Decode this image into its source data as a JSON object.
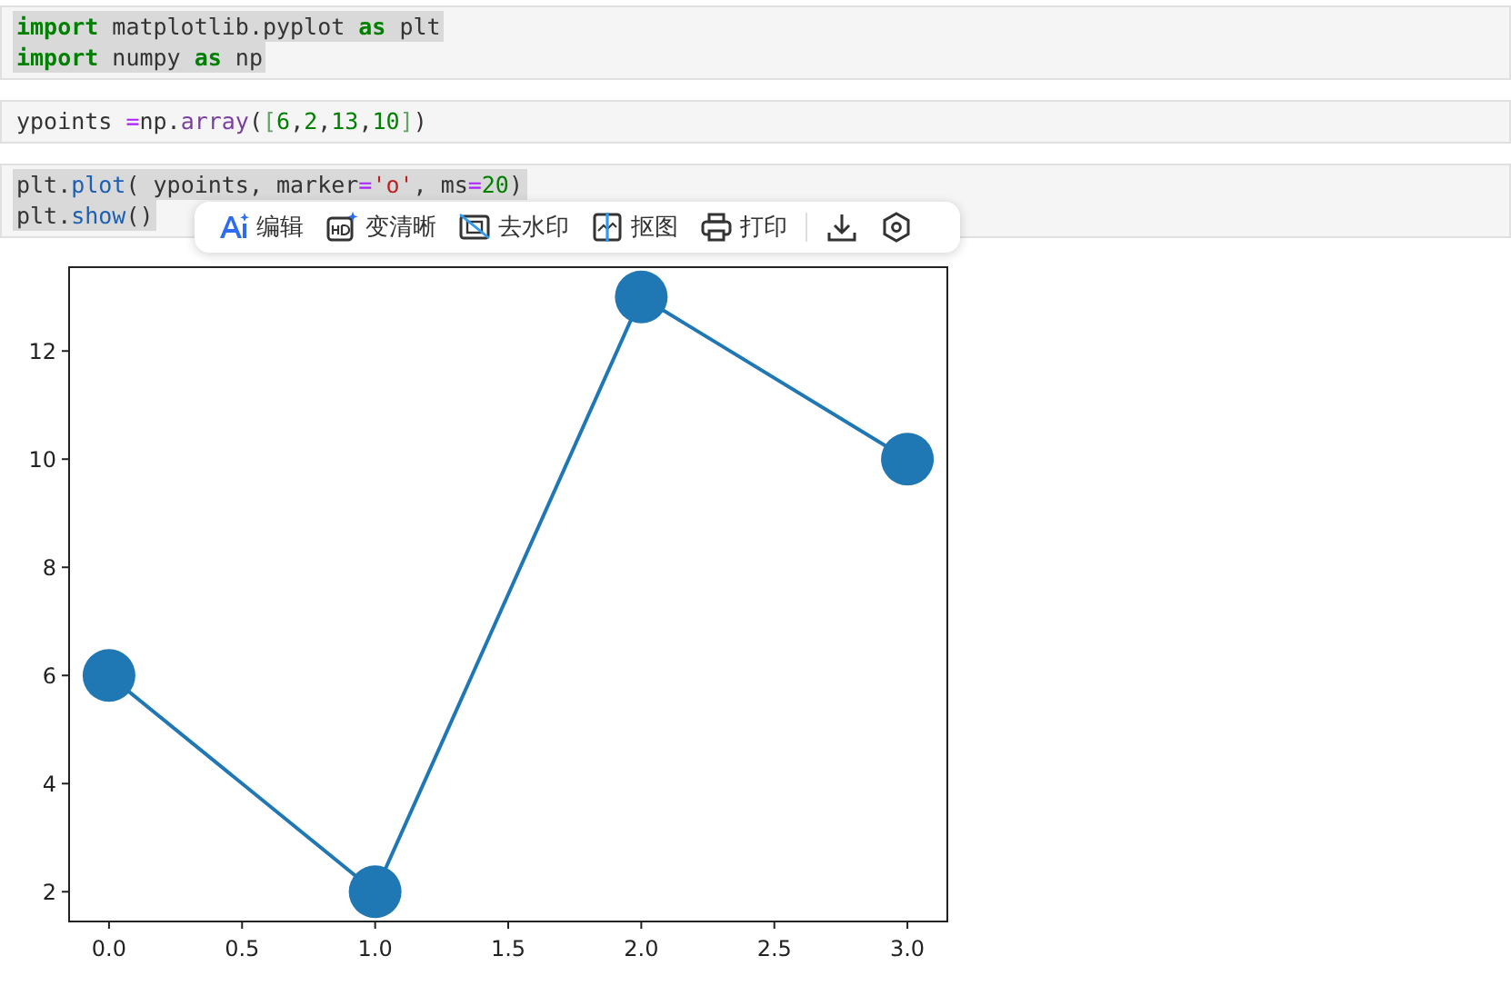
{
  "cells": [
    {
      "lines": [
        {
          "highlighted": true,
          "tokens": [
            {
              "kind": "keyword",
              "text": "import"
            },
            {
              "kind": "plain",
              "text": " matplotlib.pyplot "
            },
            {
              "kind": "keyword",
              "text": "as"
            },
            {
              "kind": "plain",
              "text": " plt"
            }
          ]
        },
        {
          "highlighted": true,
          "tokens": [
            {
              "kind": "keyword",
              "text": "import"
            },
            {
              "kind": "plain",
              "text": " numpy "
            },
            {
              "kind": "keyword",
              "text": "as"
            },
            {
              "kind": "plain",
              "text": " np"
            }
          ]
        }
      ]
    },
    {
      "lines": [
        {
          "highlighted": false,
          "tokens": [
            {
              "kind": "plain",
              "text": "ypoints "
            },
            {
              "kind": "operator",
              "text": "="
            },
            {
              "kind": "plain",
              "text": "np."
            },
            {
              "kind": "call",
              "text": "array"
            },
            {
              "kind": "plain",
              "text": "("
            },
            {
              "kind": "bracket",
              "text": "["
            },
            {
              "kind": "number",
              "text": "6"
            },
            {
              "kind": "plain",
              "text": ","
            },
            {
              "kind": "number",
              "text": "2"
            },
            {
              "kind": "plain",
              "text": ","
            },
            {
              "kind": "number",
              "text": "13"
            },
            {
              "kind": "plain",
              "text": ","
            },
            {
              "kind": "number",
              "text": "10"
            },
            {
              "kind": "bracket",
              "text": "]"
            },
            {
              "kind": "plain",
              "text": ")"
            }
          ]
        }
      ]
    },
    {
      "lines": [
        {
          "highlighted": true,
          "tokens": [
            {
              "kind": "plain",
              "text": "plt."
            },
            {
              "kind": "func",
              "text": "plot"
            },
            {
              "kind": "plain",
              "text": "( ypoints, marker"
            },
            {
              "kind": "operator",
              "text": "="
            },
            {
              "kind": "string",
              "text": "'o'"
            },
            {
              "kind": "plain",
              "text": ", ms"
            },
            {
              "kind": "operator",
              "text": "="
            },
            {
              "kind": "number",
              "text": "20"
            },
            {
              "kind": "plain",
              "text": ")"
            }
          ]
        },
        {
          "highlighted": true,
          "tokens": [
            {
              "kind": "plain",
              "text": "plt."
            },
            {
              "kind": "func",
              "text": "show"
            },
            {
              "kind": "plain",
              "text": "()"
            }
          ]
        }
      ]
    }
  ],
  "toolbar": [
    {
      "kind": "ai",
      "label": "编辑"
    },
    {
      "kind": "hd",
      "label": "变清晰"
    },
    {
      "kind": "watermark",
      "label": "去水印"
    },
    {
      "kind": "cutout",
      "label": "抠图"
    },
    {
      "kind": "print",
      "label": "打印"
    },
    {
      "kind": "download"
    },
    {
      "kind": "settings"
    }
  ],
  "chart_data": {
    "type": "line",
    "x": [
      0,
      1,
      2,
      3
    ],
    "series": [
      {
        "color": "#1f77b4",
        "marker": "o",
        "values": [
          6,
          2,
          13,
          10
        ]
      }
    ],
    "xlim": [
      -0.15,
      3.15
    ],
    "ylim": [
      1.45,
      13.55
    ],
    "xticks": [
      {
        "value": 0,
        "label": "0.0"
      },
      {
        "value": 0.5,
        "label": "0.5"
      },
      {
        "value": 1,
        "label": "1.0"
      },
      {
        "value": 1.5,
        "label": "1.5"
      },
      {
        "value": 2,
        "label": "2.0"
      },
      {
        "value": 2.5,
        "label": "2.5"
      },
      {
        "value": 3,
        "label": "3.0"
      }
    ],
    "yticks": [
      2,
      4,
      6,
      8,
      10,
      12
    ]
  }
}
